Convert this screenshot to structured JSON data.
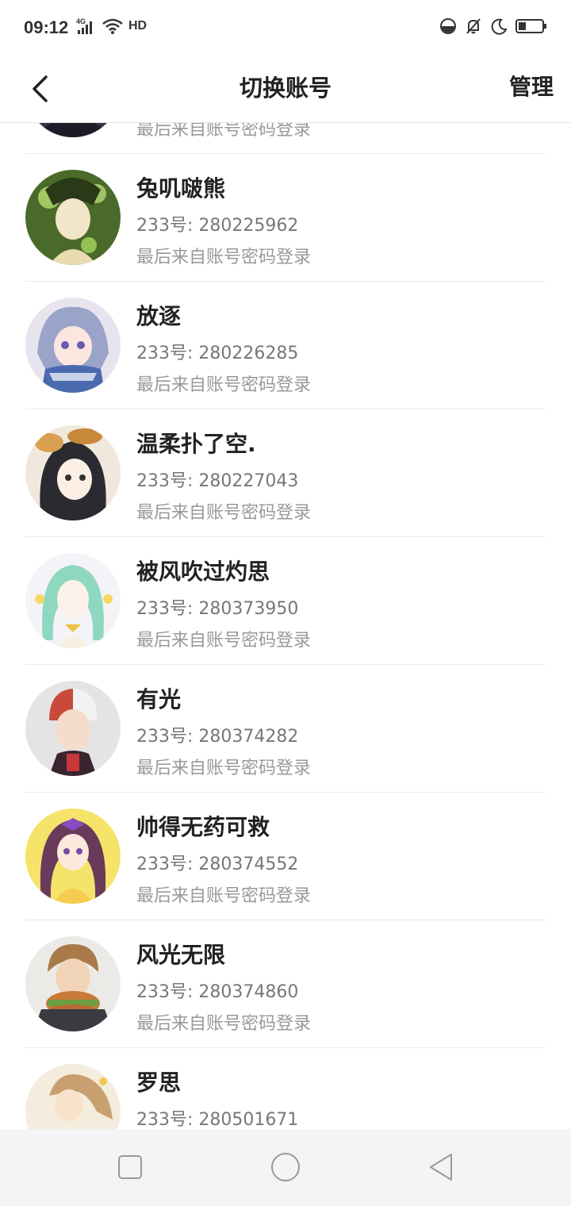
{
  "status_bar": {
    "time": "09:12",
    "network_label": "4G",
    "hd_label": "HD",
    "icons": [
      "signal-icon",
      "wifi-icon",
      "hd-icon",
      "do-not-disturb-icon",
      "mute-bell-icon",
      "moon-icon",
      "battery-icon"
    ]
  },
  "header": {
    "title": "切换账号",
    "manage_label": "管理"
  },
  "accounts": [
    {
      "name": "",
      "id": "",
      "login": "最后来自账号密码登录",
      "avatar_color": "#3b3046"
    },
    {
      "name": "兔叽啵熊",
      "id": "233号: 280225962",
      "login": "最后来自账号密码登录",
      "avatar_color": "#4a6a2a"
    },
    {
      "name": "放逐",
      "id": "233号: 280226285",
      "login": "最后来自账号密码登录",
      "avatar_color": "#9aa3c8"
    },
    {
      "name": "温柔扑了空.",
      "id": "233号: 280227043",
      "login": "最后来自账号密码登录",
      "avatar_color": "#2a2a30"
    },
    {
      "name": "被风吹过灼思",
      "id": "233号: 280373950",
      "login": "最后来自账号密码登录",
      "avatar_color": "#8fd8c0"
    },
    {
      "name": "有光",
      "id": "233号: 280374282",
      "login": "最后来自账号密码登录",
      "avatar_color": "#c94a3a"
    },
    {
      "name": "帅得无药可救",
      "id": "233号: 280374552",
      "login": "最后来自账号密码登录",
      "avatar_color": "#f5e36a"
    },
    {
      "name": "风光无限",
      "id": "233号: 280374860",
      "login": "最后来自账号密码登录",
      "avatar_color": "#a87a4a"
    },
    {
      "name": "罗思",
      "id": "233号: 280501671",
      "login": "",
      "avatar_color": "#c8a070"
    }
  ],
  "nav_bar": {
    "icons": [
      "recent-apps-icon",
      "home-icon",
      "back-triangle-icon"
    ]
  },
  "colors": {
    "divider": "#e8e8e8",
    "nav_background": "#f4f4f4",
    "secondary_text": "#999999"
  }
}
